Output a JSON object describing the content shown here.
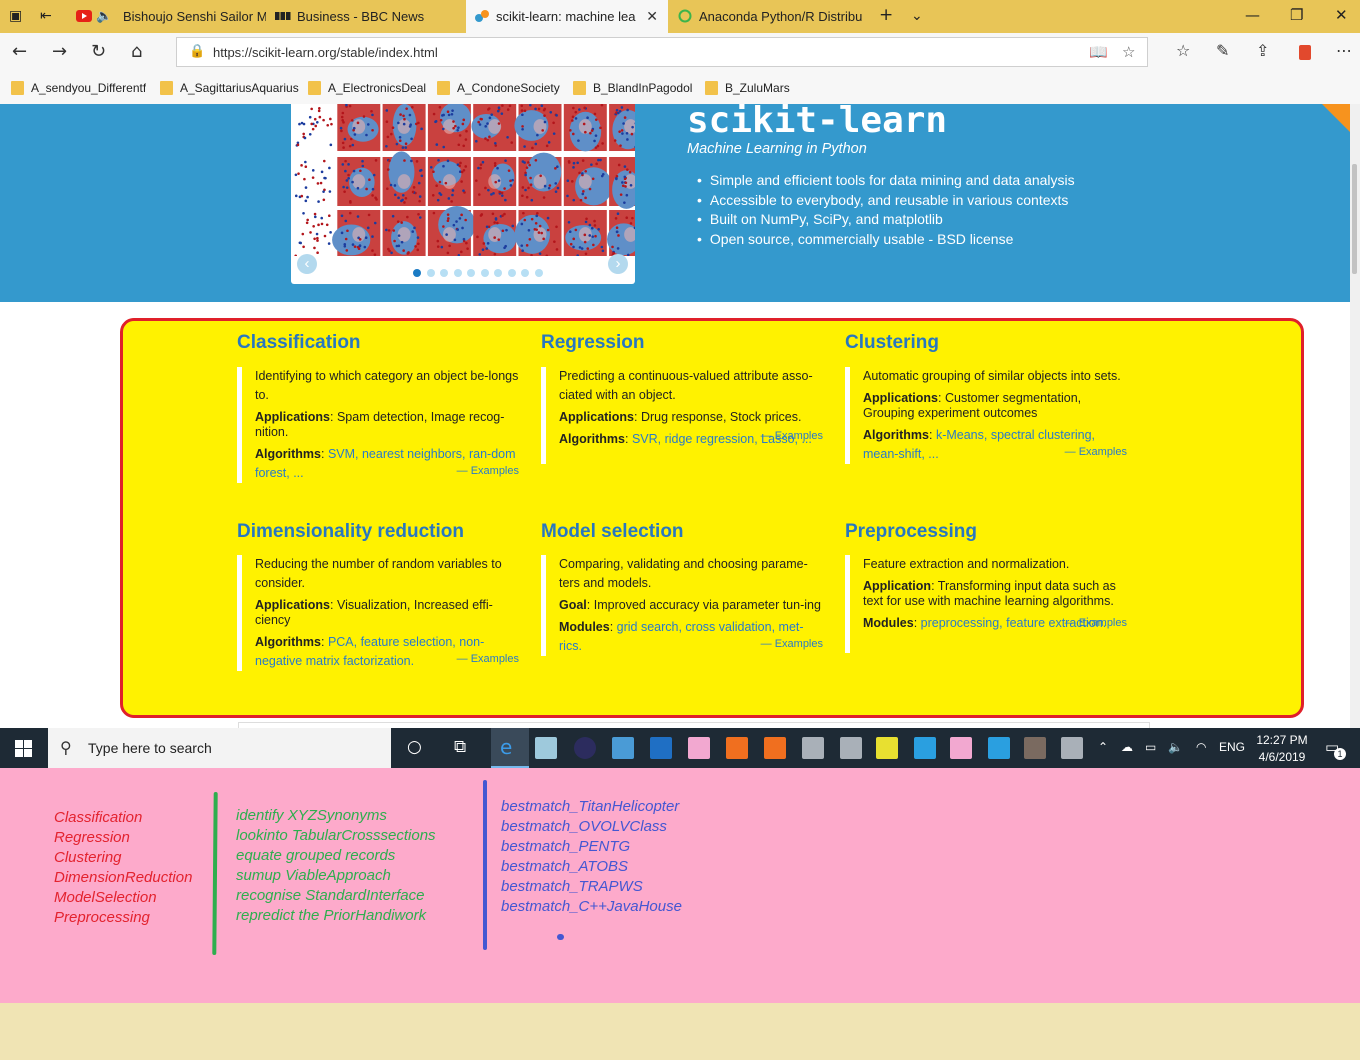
{
  "browser": {
    "tabs": [
      {
        "title": "Bishoujo Senshi Sailor M",
        "active": false,
        "icon": "youtube-icon"
      },
      {
        "title": "Business - BBC News",
        "active": false,
        "icon": "bbc-icon"
      },
      {
        "title": "scikit-learn: machine lea",
        "active": true,
        "icon": "sklearn-icon"
      },
      {
        "title": "Anaconda Python/R Distribu",
        "active": false,
        "icon": "anaconda-icon"
      }
    ],
    "url": "https://scikit-learn.org/stable/index.html",
    "favorites": [
      "A_sendyou_Differentf",
      "A_SagittariusAquarius",
      "A_ElectronicsDeal",
      "A_CondoneSociety",
      "B_BlandInPagodol",
      "B_ZuluMars"
    ]
  },
  "hero": {
    "title": "scikit-learn",
    "tagline": "Machine Learning in Python",
    "bullets": [
      "Simple and efficient tools for data mining and data analysis",
      "Accessible to everybody, and reusable in various contexts",
      "Built on NumPy, SciPy, and matplotlib",
      "Open source, commercially usable - BSD license"
    ],
    "carousel_prev": "‹",
    "carousel_next": "›",
    "carousel_dots": 10,
    "carousel_active": 0
  },
  "cards": {
    "classification": {
      "title": "Classification",
      "desc": "Identifying to which category an object be-longs to.",
      "apps_label": "Applications",
      "apps": ": Spam detection, Image recog-nition.",
      "algo_label": "Algorithms",
      "algos": "SVM, nearest neighbors, ran-dom forest, ...",
      "examples": "— Examples"
    },
    "regression": {
      "title": "Regression",
      "desc": "Predicting a continuous-valued attribute asso-ciated with an object.",
      "apps_label": "Applications",
      "apps": ": Drug response, Stock prices.",
      "algo_label": "Algorithms",
      "algos": "SVR, ridge regression, Lasso, ...",
      "examples": "— Examples"
    },
    "clustering": {
      "title": "Clustering",
      "desc": "Automatic grouping of similar objects into sets.",
      "apps_label": "Applications",
      "apps": ": Customer segmentation, Grouping experiment outcomes",
      "algo_label": "Algorithms",
      "algos": "k-Means, spectral clustering, mean-shift, ...",
      "examples": "— Examples"
    },
    "dimensionality": {
      "title": "Dimensionality reduction",
      "desc": "Reducing the number of random variables to consider.",
      "apps_label": "Applications",
      "apps": ": Visualization, Increased effi-ciency",
      "algo_label": "Algorithms",
      "algos": "PCA, feature selection, non-negative matrix factorization.",
      "examples": "— Examples"
    },
    "model_selection": {
      "title": "Model selection",
      "desc": "Comparing, validating and choosing parame-ters and models.",
      "apps_label": "Goal",
      "apps": ": Improved accuracy via parameter tun-ing",
      "algo_label": "Modules",
      "algos": "grid search, cross validation, met-rics.",
      "examples": "— Examples"
    },
    "preprocessing": {
      "title": "Preprocessing",
      "desc": "Feature extraction and normalization.",
      "apps_label": "Application",
      "apps": ": Transforming input data such as text for use with machine learning algorithms.",
      "algo_label": "Modules",
      "algos": "preprocessing, feature extraction.",
      "examples": "— Examples"
    }
  },
  "taskbar": {
    "search_placeholder": "Type here to search",
    "language": "ENG",
    "time": "12:27 PM",
    "date": "4/6/2019",
    "notification_count": "1"
  },
  "notes": {
    "red": [
      "Classification",
      "Regression",
      "Clustering",
      "DimensionReduction",
      "ModelSelection",
      "Preprocessing"
    ],
    "green": [
      "identify XYZSynonyms",
      "lookinto TabularCrosssections",
      "equate grouped records",
      "sumup ViableApproach",
      "recognise StandardInterface",
      "repredict the PriorHandiwork"
    ],
    "blue": [
      "bestmatch_TitanHelicopter",
      "bestmatch_OVOLVClass",
      "bestmatch_PENTG",
      "bestmatch_ATOBS",
      "bestmatch_TRAPWS",
      "bestmatch_C++JavaHouse"
    ]
  },
  "colors": {
    "hero_blue": "#3499cd",
    "panel_yellow": "#fff200",
    "panel_border": "#e0202a",
    "title_blue": "#2877c0",
    "note_pink": "#fdaacb",
    "note_red": "#e3232f",
    "note_green": "#2eae4e",
    "note_blue": "#4457d2"
  }
}
